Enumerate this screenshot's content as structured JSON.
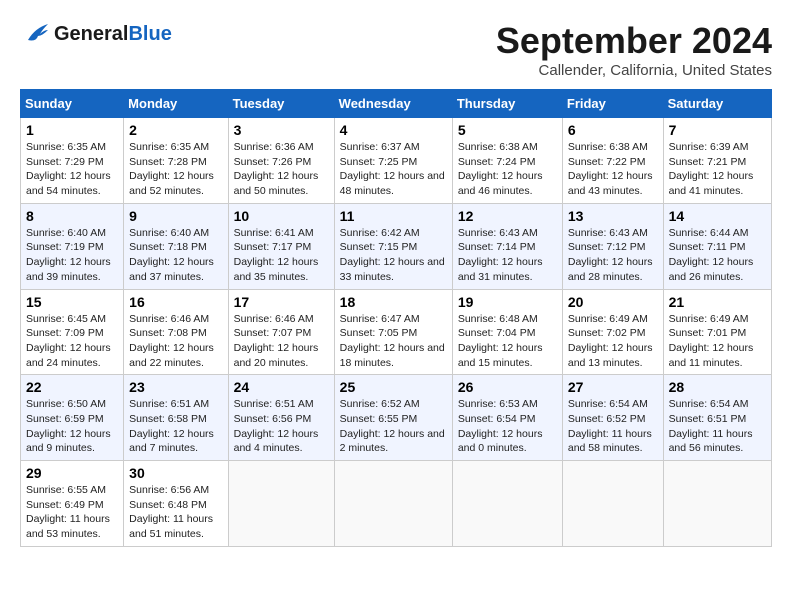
{
  "header": {
    "logo_general": "General",
    "logo_blue": "Blue",
    "month": "September 2024",
    "location": "Callender, California, United States"
  },
  "weekdays": [
    "Sunday",
    "Monday",
    "Tuesday",
    "Wednesday",
    "Thursday",
    "Friday",
    "Saturday"
  ],
  "weeks": [
    [
      {
        "day": "1",
        "sunrise": "6:35 AM",
        "sunset": "7:29 PM",
        "daylight": "12 hours and 54 minutes."
      },
      {
        "day": "2",
        "sunrise": "6:35 AM",
        "sunset": "7:28 PM",
        "daylight": "12 hours and 52 minutes."
      },
      {
        "day": "3",
        "sunrise": "6:36 AM",
        "sunset": "7:26 PM",
        "daylight": "12 hours and 50 minutes."
      },
      {
        "day": "4",
        "sunrise": "6:37 AM",
        "sunset": "7:25 PM",
        "daylight": "12 hours and 48 minutes."
      },
      {
        "day": "5",
        "sunrise": "6:38 AM",
        "sunset": "7:24 PM",
        "daylight": "12 hours and 46 minutes."
      },
      {
        "day": "6",
        "sunrise": "6:38 AM",
        "sunset": "7:22 PM",
        "daylight": "12 hours and 43 minutes."
      },
      {
        "day": "7",
        "sunrise": "6:39 AM",
        "sunset": "7:21 PM",
        "daylight": "12 hours and 41 minutes."
      }
    ],
    [
      {
        "day": "8",
        "sunrise": "6:40 AM",
        "sunset": "7:19 PM",
        "daylight": "12 hours and 39 minutes."
      },
      {
        "day": "9",
        "sunrise": "6:40 AM",
        "sunset": "7:18 PM",
        "daylight": "12 hours and 37 minutes."
      },
      {
        "day": "10",
        "sunrise": "6:41 AM",
        "sunset": "7:17 PM",
        "daylight": "12 hours and 35 minutes."
      },
      {
        "day": "11",
        "sunrise": "6:42 AM",
        "sunset": "7:15 PM",
        "daylight": "12 hours and 33 minutes."
      },
      {
        "day": "12",
        "sunrise": "6:43 AM",
        "sunset": "7:14 PM",
        "daylight": "12 hours and 31 minutes."
      },
      {
        "day": "13",
        "sunrise": "6:43 AM",
        "sunset": "7:12 PM",
        "daylight": "12 hours and 28 minutes."
      },
      {
        "day": "14",
        "sunrise": "6:44 AM",
        "sunset": "7:11 PM",
        "daylight": "12 hours and 26 minutes."
      }
    ],
    [
      {
        "day": "15",
        "sunrise": "6:45 AM",
        "sunset": "7:09 PM",
        "daylight": "12 hours and 24 minutes."
      },
      {
        "day": "16",
        "sunrise": "6:46 AM",
        "sunset": "7:08 PM",
        "daylight": "12 hours and 22 minutes."
      },
      {
        "day": "17",
        "sunrise": "6:46 AM",
        "sunset": "7:07 PM",
        "daylight": "12 hours and 20 minutes."
      },
      {
        "day": "18",
        "sunrise": "6:47 AM",
        "sunset": "7:05 PM",
        "daylight": "12 hours and 18 minutes."
      },
      {
        "day": "19",
        "sunrise": "6:48 AM",
        "sunset": "7:04 PM",
        "daylight": "12 hours and 15 minutes."
      },
      {
        "day": "20",
        "sunrise": "6:49 AM",
        "sunset": "7:02 PM",
        "daylight": "12 hours and 13 minutes."
      },
      {
        "day": "21",
        "sunrise": "6:49 AM",
        "sunset": "7:01 PM",
        "daylight": "12 hours and 11 minutes."
      }
    ],
    [
      {
        "day": "22",
        "sunrise": "6:50 AM",
        "sunset": "6:59 PM",
        "daylight": "12 hours and 9 minutes."
      },
      {
        "day": "23",
        "sunrise": "6:51 AM",
        "sunset": "6:58 PM",
        "daylight": "12 hours and 7 minutes."
      },
      {
        "day": "24",
        "sunrise": "6:51 AM",
        "sunset": "6:56 PM",
        "daylight": "12 hours and 4 minutes."
      },
      {
        "day": "25",
        "sunrise": "6:52 AM",
        "sunset": "6:55 PM",
        "daylight": "12 hours and 2 minutes."
      },
      {
        "day": "26",
        "sunrise": "6:53 AM",
        "sunset": "6:54 PM",
        "daylight": "12 hours and 0 minutes."
      },
      {
        "day": "27",
        "sunrise": "6:54 AM",
        "sunset": "6:52 PM",
        "daylight": "11 hours and 58 minutes."
      },
      {
        "day": "28",
        "sunrise": "6:54 AM",
        "sunset": "6:51 PM",
        "daylight": "11 hours and 56 minutes."
      }
    ],
    [
      {
        "day": "29",
        "sunrise": "6:55 AM",
        "sunset": "6:49 PM",
        "daylight": "11 hours and 53 minutes."
      },
      {
        "day": "30",
        "sunrise": "6:56 AM",
        "sunset": "6:48 PM",
        "daylight": "11 hours and 51 minutes."
      },
      null,
      null,
      null,
      null,
      null
    ]
  ],
  "labels": {
    "sunrise": "Sunrise:",
    "sunset": "Sunset:",
    "daylight": "Daylight:"
  }
}
